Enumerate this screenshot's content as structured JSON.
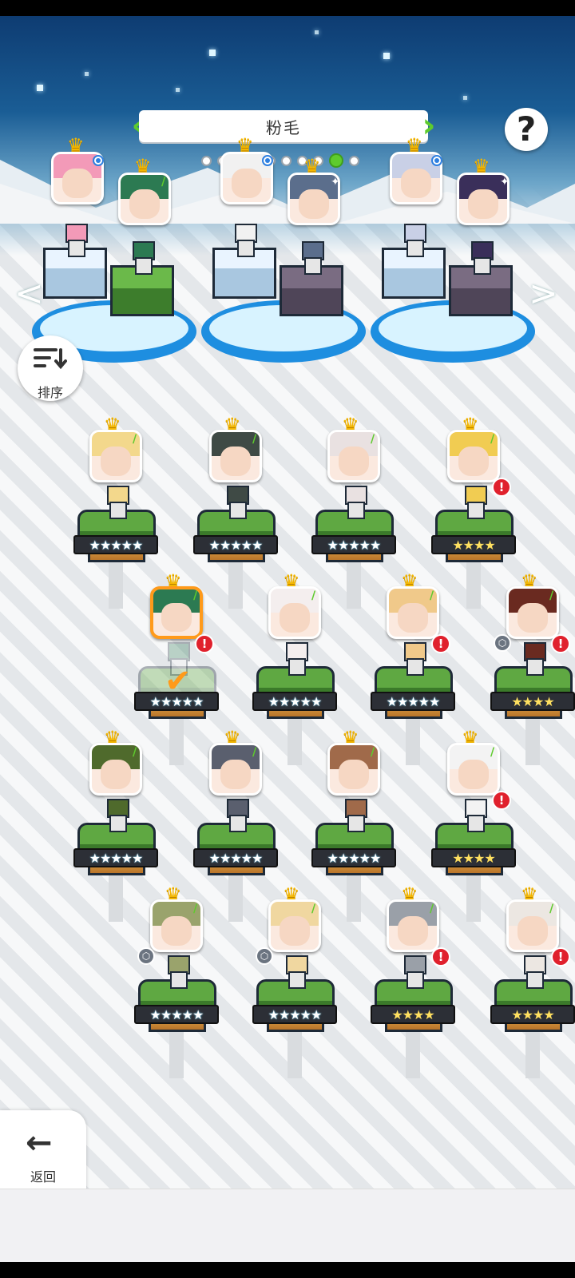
{
  "header": {
    "title": "粉毛",
    "page_count": 10,
    "current_page": 9
  },
  "help_label": "?",
  "sort": {
    "label": "排序"
  },
  "back": {
    "label": "返回"
  },
  "nav": {
    "left": "<",
    "right": ">"
  },
  "top_teams": [
    {
      "slots": [
        {
          "color": "#f39ab8",
          "rank": "blue"
        },
        {
          "color": "#2c7a52",
          "rank": "leaf"
        }
      ]
    },
    {
      "slots": [
        {
          "color": "#f1f1f1",
          "rank": "blue"
        },
        {
          "color": "#5b6e8c",
          "rank": "dark"
        }
      ]
    },
    {
      "slots": [
        {
          "color": "#c9d0e6",
          "rank": "blue"
        },
        {
          "color": "#3a2f5a",
          "rank": "dark"
        }
      ]
    }
  ],
  "roster": [
    {
      "stars": "★★★★★",
      "rainbow": true,
      "color": "#f3d88c",
      "alert": false,
      "badge": false,
      "selected": false
    },
    {
      "stars": "★★★★★",
      "rainbow": true,
      "color": "#3f4a45",
      "alert": false,
      "badge": false,
      "selected": false
    },
    {
      "stars": "★★★★★",
      "rainbow": true,
      "color": "#e9e1e1",
      "alert": false,
      "badge": false,
      "selected": false
    },
    {
      "stars": "★★★★",
      "rainbow": false,
      "color": "#f1cc52",
      "alert": true,
      "badge": false,
      "selected": false
    },
    {
      "stars": "★★★★★",
      "rainbow": true,
      "color": "#2c7a52",
      "alert": true,
      "badge": false,
      "selected": true
    },
    {
      "stars": "★★★★★",
      "rainbow": true,
      "color": "#f4eeee",
      "alert": false,
      "badge": false,
      "selected": false
    },
    {
      "stars": "★★★★★",
      "rainbow": true,
      "color": "#f0c98a",
      "alert": true,
      "badge": false,
      "selected": false
    },
    {
      "stars": "★★★★",
      "rainbow": false,
      "color": "#6a2a20",
      "alert": true,
      "badge": true,
      "selected": false
    },
    {
      "stars": "★★★★★",
      "rainbow": true,
      "color": "#4f6a2c",
      "alert": false,
      "badge": false,
      "selected": false
    },
    {
      "stars": "★★★★★",
      "rainbow": true,
      "color": "#5a5f6e",
      "alert": false,
      "badge": false,
      "selected": false
    },
    {
      "stars": "★★★★★",
      "rainbow": true,
      "color": "#a06a4a",
      "alert": false,
      "badge": false,
      "selected": false
    },
    {
      "stars": "★★★★",
      "rainbow": false,
      "color": "#f3f3f3",
      "alert": true,
      "badge": false,
      "selected": false
    },
    {
      "stars": "★★★★★",
      "rainbow": true,
      "color": "#9aa36c",
      "alert": false,
      "badge": true,
      "selected": false
    },
    {
      "stars": "★★★★★",
      "rainbow": true,
      "color": "#f0d7a0",
      "alert": false,
      "badge": true,
      "selected": false
    },
    {
      "stars": "★★★★",
      "rainbow": false,
      "color": "#9aa0a8",
      "alert": true,
      "badge": false,
      "selected": false
    },
    {
      "stars": "★★★★",
      "rainbow": false,
      "color": "#ece7e2",
      "alert": true,
      "badge": false,
      "selected": false
    }
  ],
  "colors": {
    "accent": "#5ecb2d",
    "alert": "#e0212d",
    "selected": "#ff9a1a",
    "crown": "#f5b800"
  }
}
